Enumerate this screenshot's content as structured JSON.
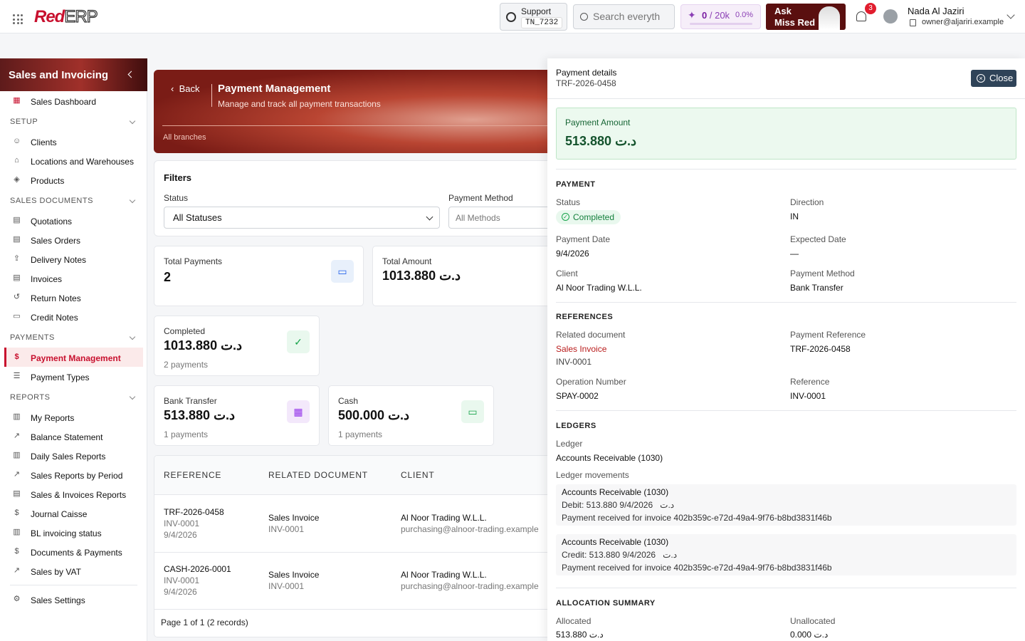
{
  "topbar": {
    "logo_red": "Red",
    "logo_erp": "ERP",
    "support_label": "Support",
    "support_code": "TN_7232",
    "search_placeholder": "Search everyth",
    "usage_count": "0",
    "usage_total": "/ 20k",
    "usage_pct": "0.0%",
    "ask_line1": "Ask",
    "ask_line2": "Miss Red",
    "notif_count": "3",
    "user_name": "Nada Al Jaziri",
    "user_email": "owner@aljariri.example"
  },
  "sidebar": {
    "title": "Sales and Invoicing",
    "dashboard": "Sales Dashboard",
    "sections": [
      {
        "title": "SETUP",
        "items": [
          "Clients",
          "Locations and Warehouses",
          "Products"
        ]
      },
      {
        "title": "SALES DOCUMENTS",
        "items": [
          "Quotations",
          "Sales Orders",
          "Delivery Notes",
          "Invoices",
          "Return Notes",
          "Credit Notes"
        ]
      },
      {
        "title": "PAYMENTS",
        "items": [
          "Payment Management",
          "Payment Types"
        ]
      },
      {
        "title": "REPORTS",
        "items": [
          "My Reports",
          "Balance Statement",
          "Daily Sales Reports",
          "Sales Reports by Period",
          "Sales & Invoices Reports",
          "Journal Caisse",
          "BL invoicing status",
          "Documents & Payments",
          "Sales by VAT"
        ]
      }
    ],
    "settings": "Sales Settings"
  },
  "banner": {
    "back": "Back",
    "title": "Payment Management",
    "subtitle": "Manage and track all payment transactions",
    "branch": "All branches"
  },
  "filters": {
    "title": "Filters",
    "status_label": "Status",
    "status_value": "All Statuses",
    "method_label": "Payment Method",
    "method_value": "All Methods"
  },
  "stats": {
    "total_payments_label": "Total Payments",
    "total_payments_value": "2",
    "total_amount_label": "Total Amount",
    "total_amount_value": "1013.880 د.ت",
    "completed_label": "Completed",
    "completed_value": "1013.880 د.ت",
    "completed_count": "2 payments",
    "bank_label": "Bank Transfer",
    "bank_value": "513.880 د.ت",
    "bank_count": "1 payments",
    "cash_label": "Cash",
    "cash_value": "500.000 د.ت",
    "cash_count": "1 payments"
  },
  "table": {
    "headers": [
      "REFERENCE",
      "RELATED DOCUMENT",
      "CLIENT"
    ],
    "rows": [
      {
        "ref": "TRF-2026-0458",
        "doc": "INV-0001",
        "date": "9/4/2026",
        "rel_type": "Sales Invoice",
        "rel_doc": "INV-0001",
        "client": "Al Noor Trading W.L.L.",
        "client_email": "purchasing@alnoor-trading.example"
      },
      {
        "ref": "CASH-2026-0001",
        "doc": "INV-0001",
        "date": "9/4/2026",
        "rel_type": "Sales Invoice",
        "rel_doc": "INV-0001",
        "client": "Al Noor Trading W.L.L.",
        "client_email": "purchasing@alnoor-trading.example"
      }
    ],
    "pager": "Page 1 of 1 (2 records)"
  },
  "panel": {
    "title": "Payment details",
    "subtitle": "TRF-2026-0458",
    "close": "Close",
    "amount_label": "Payment Amount",
    "amount_value": "513.880 د.ت",
    "payment": {
      "section": "PAYMENT",
      "status_label": "Status",
      "status_value": "Completed",
      "direction_label": "Direction",
      "direction_value": "IN",
      "date_label": "Payment Date",
      "date_value": "9/4/2026",
      "expected_label": "Expected Date",
      "expected_value": "—",
      "client_label": "Client",
      "client_value": "Al Noor Trading W.L.L.",
      "method_label": "Payment Method",
      "method_value": "Bank Transfer"
    },
    "references": {
      "section": "REFERENCES",
      "related_label": "Related document",
      "related_type": "Sales Invoice",
      "related_doc": "INV-0001",
      "payref_label": "Payment Reference",
      "payref_value": "TRF-2026-0458",
      "opnum_label": "Operation Number",
      "opnum_value": "SPAY-0002",
      "ref_label": "Reference",
      "ref_value": "INV-0001"
    },
    "ledgers": {
      "section": "LEDGERS",
      "ledger_label": "Ledger",
      "ledger_value": "Accounts Receivable (1030)",
      "movements_label": "Ledger movements",
      "movements": [
        {
          "account": "Accounts Receivable (1030)",
          "amount": "Debit: 513.880 د.ت",
          "date": "9/4/2026",
          "memo": "Payment received for invoice 402b359c-e72d-49a4-9f76-b8bd3831f46b"
        },
        {
          "account": "Accounts Receivable (1030)",
          "amount": "Credit: 513.880 د.ت",
          "date": "9/4/2026",
          "memo": "Payment received for invoice 402b359c-e72d-49a4-9f76-b8bd3831f46b"
        }
      ]
    },
    "allocation": {
      "section": "ALLOCATION SUMMARY",
      "allocated_label": "Allocated",
      "allocated_value": "513.880 د.ت",
      "unallocated_label": "Unallocated",
      "unallocated_value": "0.000 د.ت"
    }
  }
}
